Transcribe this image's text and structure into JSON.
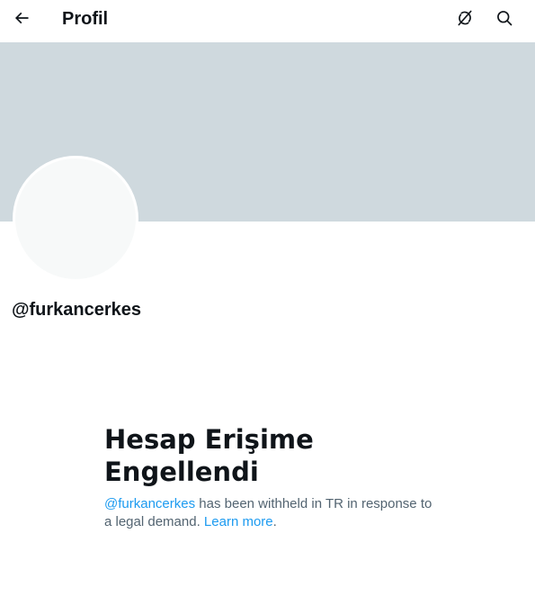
{
  "header": {
    "back_icon": "arrow-left-icon",
    "title": "Profil",
    "grok_icon": "grok-icon",
    "search_icon": "search-icon"
  },
  "profile": {
    "handle": "@furkancerkes"
  },
  "withheld": {
    "title": "Hesap Erişime Engellendi",
    "mention": "@furkancerkes",
    "message": " has been withheld in TR in response to a legal demand. ",
    "learn_more": "Learn more",
    "period": "."
  },
  "colors": {
    "banner": "#cfd9de",
    "avatar": "#f7f9f9",
    "link": "#1d9bf0",
    "text_secondary": "#536471",
    "text_primary": "#0f1419"
  }
}
